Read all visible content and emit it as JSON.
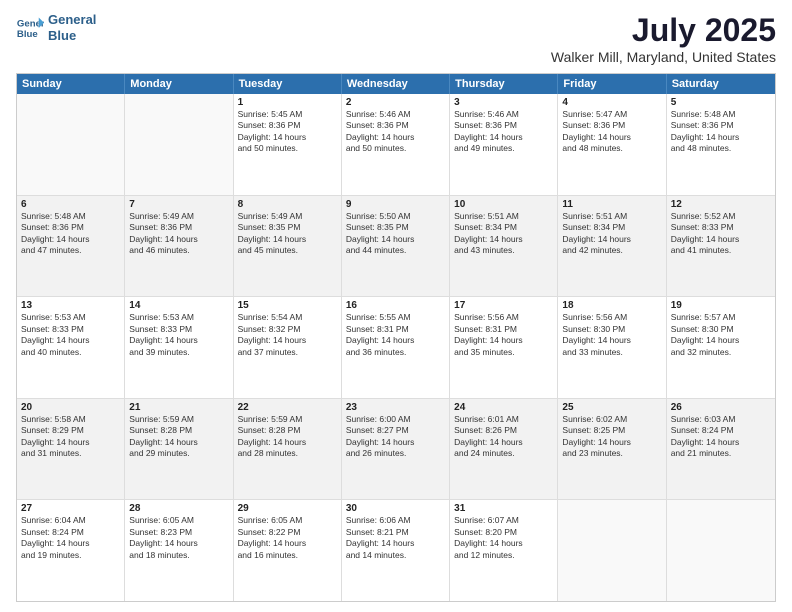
{
  "header": {
    "logo_line1": "General",
    "logo_line2": "Blue",
    "month": "July 2025",
    "location": "Walker Mill, Maryland, United States"
  },
  "weekdays": [
    "Sunday",
    "Monday",
    "Tuesday",
    "Wednesday",
    "Thursday",
    "Friday",
    "Saturday"
  ],
  "rows": [
    [
      {
        "day": "",
        "empty": true
      },
      {
        "day": "",
        "empty": true
      },
      {
        "day": "1",
        "lines": [
          "Sunrise: 5:45 AM",
          "Sunset: 8:36 PM",
          "Daylight: 14 hours",
          "and 50 minutes."
        ]
      },
      {
        "day": "2",
        "lines": [
          "Sunrise: 5:46 AM",
          "Sunset: 8:36 PM",
          "Daylight: 14 hours",
          "and 50 minutes."
        ]
      },
      {
        "day": "3",
        "lines": [
          "Sunrise: 5:46 AM",
          "Sunset: 8:36 PM",
          "Daylight: 14 hours",
          "and 49 minutes."
        ]
      },
      {
        "day": "4",
        "lines": [
          "Sunrise: 5:47 AM",
          "Sunset: 8:36 PM",
          "Daylight: 14 hours",
          "and 48 minutes."
        ]
      },
      {
        "day": "5",
        "lines": [
          "Sunrise: 5:48 AM",
          "Sunset: 8:36 PM",
          "Daylight: 14 hours",
          "and 48 minutes."
        ]
      }
    ],
    [
      {
        "day": "6",
        "lines": [
          "Sunrise: 5:48 AM",
          "Sunset: 8:36 PM",
          "Daylight: 14 hours",
          "and 47 minutes."
        ],
        "shaded": true
      },
      {
        "day": "7",
        "lines": [
          "Sunrise: 5:49 AM",
          "Sunset: 8:36 PM",
          "Daylight: 14 hours",
          "and 46 minutes."
        ],
        "shaded": true
      },
      {
        "day": "8",
        "lines": [
          "Sunrise: 5:49 AM",
          "Sunset: 8:35 PM",
          "Daylight: 14 hours",
          "and 45 minutes."
        ],
        "shaded": true
      },
      {
        "day": "9",
        "lines": [
          "Sunrise: 5:50 AM",
          "Sunset: 8:35 PM",
          "Daylight: 14 hours",
          "and 44 minutes."
        ],
        "shaded": true
      },
      {
        "day": "10",
        "lines": [
          "Sunrise: 5:51 AM",
          "Sunset: 8:34 PM",
          "Daylight: 14 hours",
          "and 43 minutes."
        ],
        "shaded": true
      },
      {
        "day": "11",
        "lines": [
          "Sunrise: 5:51 AM",
          "Sunset: 8:34 PM",
          "Daylight: 14 hours",
          "and 42 minutes."
        ],
        "shaded": true
      },
      {
        "day": "12",
        "lines": [
          "Sunrise: 5:52 AM",
          "Sunset: 8:33 PM",
          "Daylight: 14 hours",
          "and 41 minutes."
        ],
        "shaded": true
      }
    ],
    [
      {
        "day": "13",
        "lines": [
          "Sunrise: 5:53 AM",
          "Sunset: 8:33 PM",
          "Daylight: 14 hours",
          "and 40 minutes."
        ]
      },
      {
        "day": "14",
        "lines": [
          "Sunrise: 5:53 AM",
          "Sunset: 8:33 PM",
          "Daylight: 14 hours",
          "and 39 minutes."
        ]
      },
      {
        "day": "15",
        "lines": [
          "Sunrise: 5:54 AM",
          "Sunset: 8:32 PM",
          "Daylight: 14 hours",
          "and 37 minutes."
        ]
      },
      {
        "day": "16",
        "lines": [
          "Sunrise: 5:55 AM",
          "Sunset: 8:31 PM",
          "Daylight: 14 hours",
          "and 36 minutes."
        ]
      },
      {
        "day": "17",
        "lines": [
          "Sunrise: 5:56 AM",
          "Sunset: 8:31 PM",
          "Daylight: 14 hours",
          "and 35 minutes."
        ]
      },
      {
        "day": "18",
        "lines": [
          "Sunrise: 5:56 AM",
          "Sunset: 8:30 PM",
          "Daylight: 14 hours",
          "and 33 minutes."
        ]
      },
      {
        "day": "19",
        "lines": [
          "Sunrise: 5:57 AM",
          "Sunset: 8:30 PM",
          "Daylight: 14 hours",
          "and 32 minutes."
        ]
      }
    ],
    [
      {
        "day": "20",
        "lines": [
          "Sunrise: 5:58 AM",
          "Sunset: 8:29 PM",
          "Daylight: 14 hours",
          "and 31 minutes."
        ],
        "shaded": true
      },
      {
        "day": "21",
        "lines": [
          "Sunrise: 5:59 AM",
          "Sunset: 8:28 PM",
          "Daylight: 14 hours",
          "and 29 minutes."
        ],
        "shaded": true
      },
      {
        "day": "22",
        "lines": [
          "Sunrise: 5:59 AM",
          "Sunset: 8:28 PM",
          "Daylight: 14 hours",
          "and 28 minutes."
        ],
        "shaded": true
      },
      {
        "day": "23",
        "lines": [
          "Sunrise: 6:00 AM",
          "Sunset: 8:27 PM",
          "Daylight: 14 hours",
          "and 26 minutes."
        ],
        "shaded": true
      },
      {
        "day": "24",
        "lines": [
          "Sunrise: 6:01 AM",
          "Sunset: 8:26 PM",
          "Daylight: 14 hours",
          "and 24 minutes."
        ],
        "shaded": true
      },
      {
        "day": "25",
        "lines": [
          "Sunrise: 6:02 AM",
          "Sunset: 8:25 PM",
          "Daylight: 14 hours",
          "and 23 minutes."
        ],
        "shaded": true
      },
      {
        "day": "26",
        "lines": [
          "Sunrise: 6:03 AM",
          "Sunset: 8:24 PM",
          "Daylight: 14 hours",
          "and 21 minutes."
        ],
        "shaded": true
      }
    ],
    [
      {
        "day": "27",
        "lines": [
          "Sunrise: 6:04 AM",
          "Sunset: 8:24 PM",
          "Daylight: 14 hours",
          "and 19 minutes."
        ]
      },
      {
        "day": "28",
        "lines": [
          "Sunrise: 6:05 AM",
          "Sunset: 8:23 PM",
          "Daylight: 14 hours",
          "and 18 minutes."
        ]
      },
      {
        "day": "29",
        "lines": [
          "Sunrise: 6:05 AM",
          "Sunset: 8:22 PM",
          "Daylight: 14 hours",
          "and 16 minutes."
        ]
      },
      {
        "day": "30",
        "lines": [
          "Sunrise: 6:06 AM",
          "Sunset: 8:21 PM",
          "Daylight: 14 hours",
          "and 14 minutes."
        ]
      },
      {
        "day": "31",
        "lines": [
          "Sunrise: 6:07 AM",
          "Sunset: 8:20 PM",
          "Daylight: 14 hours",
          "and 12 minutes."
        ]
      },
      {
        "day": "",
        "empty": true
      },
      {
        "day": "",
        "empty": true
      }
    ]
  ]
}
